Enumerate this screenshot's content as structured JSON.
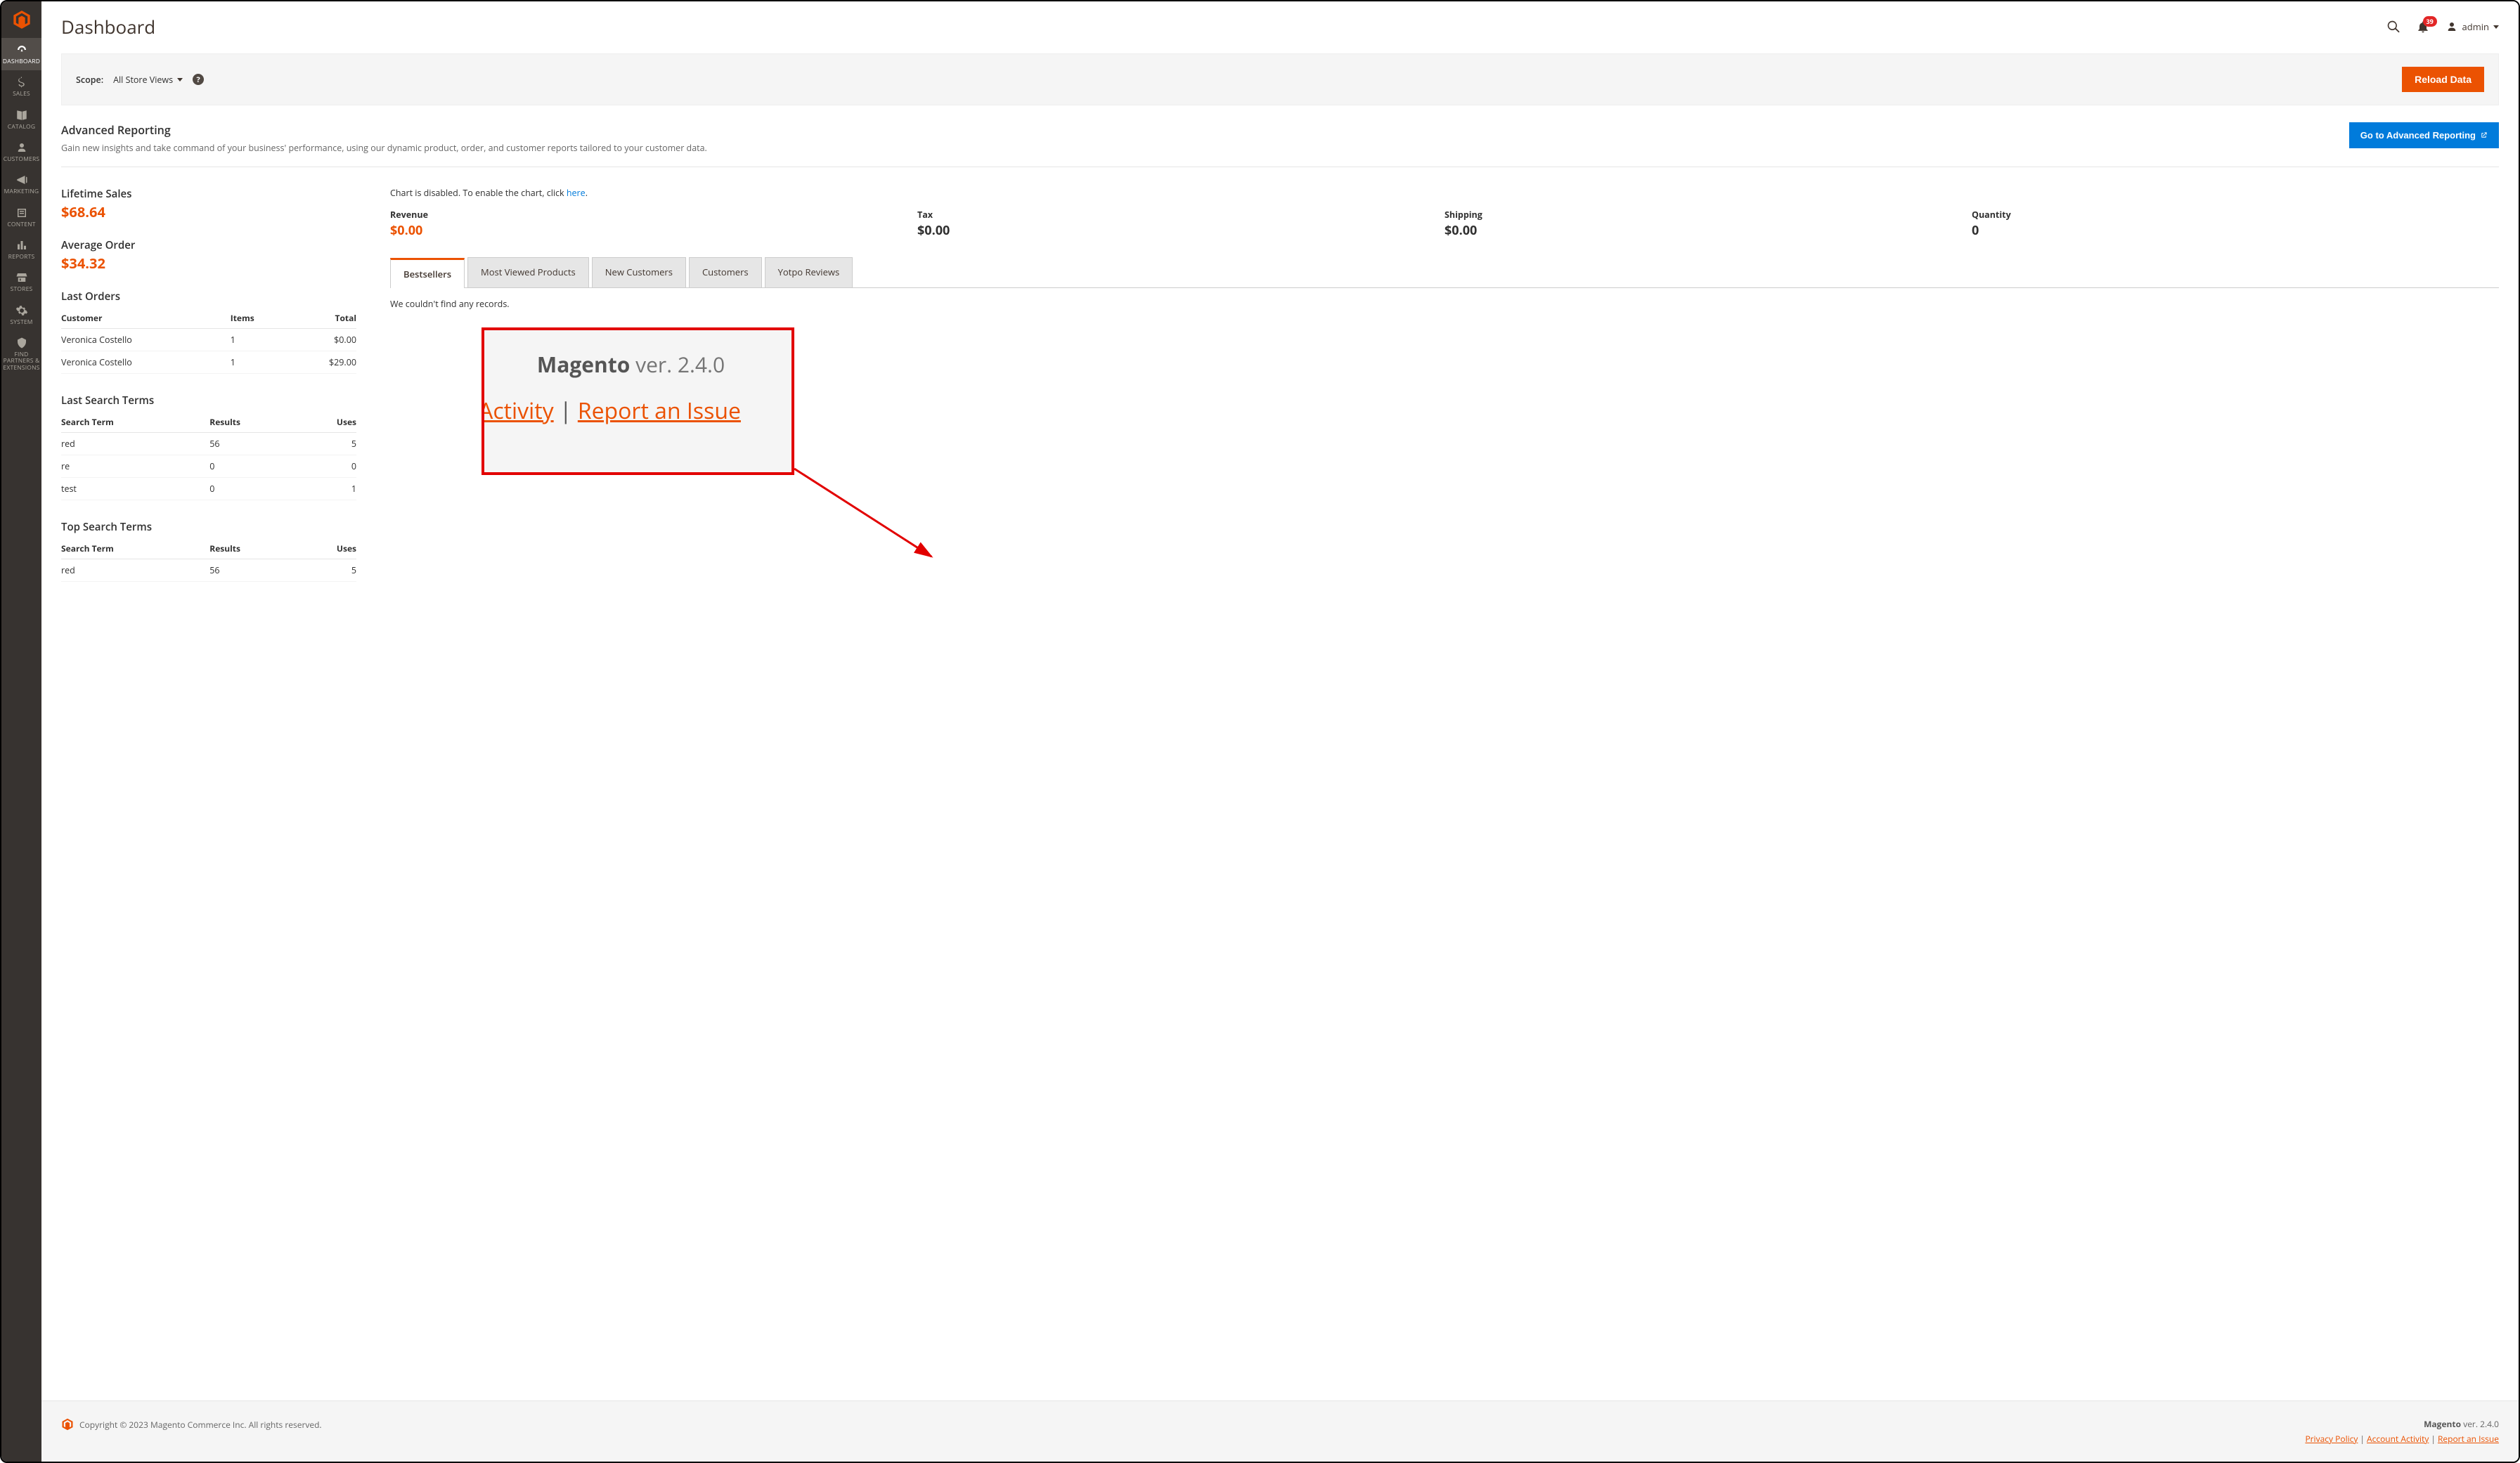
{
  "page_title": "Dashboard",
  "user": {
    "name": "admin",
    "notification_count": "39"
  },
  "sidebar": {
    "items": [
      {
        "label": "DASHBOARD",
        "active": true
      },
      {
        "label": "SALES"
      },
      {
        "label": "CATALOG"
      },
      {
        "label": "CUSTOMERS"
      },
      {
        "label": "MARKETING"
      },
      {
        "label": "CONTENT"
      },
      {
        "label": "REPORTS"
      },
      {
        "label": "STORES"
      },
      {
        "label": "SYSTEM"
      },
      {
        "label": "FIND PARTNERS & EXTENSIONS"
      }
    ]
  },
  "scope": {
    "label": "Scope:",
    "value": "All Store Views",
    "reload_button": "Reload Data"
  },
  "adv_report": {
    "title": "Advanced Reporting",
    "desc": "Gain new insights and take command of your business' performance, using our dynamic product, order, and customer reports tailored to your customer data.",
    "button": "Go to Advanced Reporting"
  },
  "lifetime_sales": {
    "label": "Lifetime Sales",
    "value": "$68.64"
  },
  "avg_order": {
    "label": "Average Order",
    "value": "$34.32"
  },
  "last_orders": {
    "title": "Last Orders",
    "cols": {
      "c1": "Customer",
      "c2": "Items",
      "c3": "Total"
    },
    "rows": [
      {
        "customer": "Veronica Costello",
        "items": "1",
        "total": "$0.00"
      },
      {
        "customer": "Veronica Costello",
        "items": "1",
        "total": "$29.00"
      }
    ]
  },
  "last_search": {
    "title": "Last Search Terms",
    "cols": {
      "c1": "Search Term",
      "c2": "Results",
      "c3": "Uses"
    },
    "rows": [
      {
        "term": "red",
        "results": "56",
        "uses": "5"
      },
      {
        "term": "re",
        "results": "0",
        "uses": "0"
      },
      {
        "term": "test",
        "results": "0",
        "uses": "1"
      }
    ]
  },
  "top_search": {
    "title": "Top Search Terms",
    "cols": {
      "c1": "Search Term",
      "c2": "Results",
      "c3": "Uses"
    },
    "rows": [
      {
        "term": "red",
        "results": "56",
        "uses": "5"
      }
    ]
  },
  "chart_note": {
    "prefix": "Chart is disabled. To enable the chart, click ",
    "link": "here",
    "suffix": "."
  },
  "metrics": {
    "revenue": {
      "label": "Revenue",
      "value": "$0.00"
    },
    "tax": {
      "label": "Tax",
      "value": "$0.00"
    },
    "shipping": {
      "label": "Shipping",
      "value": "$0.00"
    },
    "quantity": {
      "label": "Quantity",
      "value": "0"
    }
  },
  "tabs": [
    "Bestsellers",
    "Most Viewed Products",
    "New Customers",
    "Customers",
    "Yotpo Reviews"
  ],
  "no_records": "We couldn't find any records.",
  "callout": {
    "line1_bold": "Magento",
    "line1_rest": " ver. 2.4.0",
    "activity": "Activity",
    "sep": " | ",
    "report": "Report an Issue"
  },
  "footer": {
    "copyright": "Copyright © 2023 Magento Commerce Inc. All rights reserved.",
    "ver_bold": "Magento",
    "ver_rest": " ver. 2.4.0",
    "links": {
      "privacy": "Privacy Policy",
      "activity": "Account Activity",
      "report": "Report an Issue"
    }
  }
}
